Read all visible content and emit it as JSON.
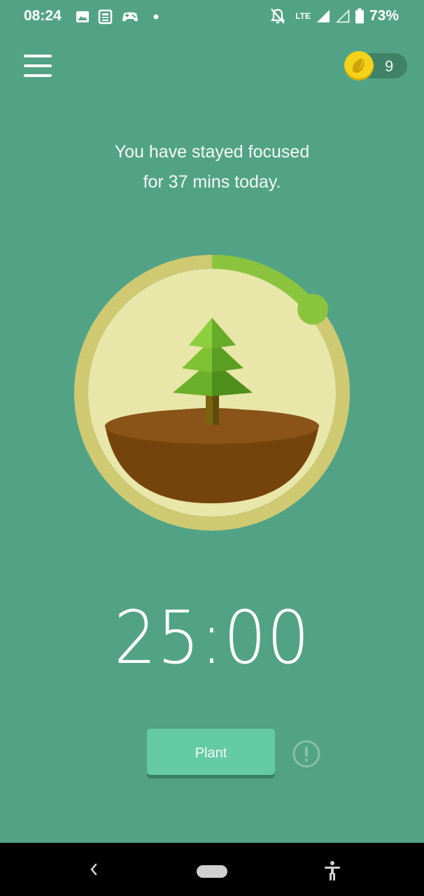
{
  "status_bar": {
    "time": "08:24",
    "left_icons": [
      "image-icon",
      "news-icon",
      "game-controller-icon",
      "dot-icon"
    ],
    "right_icons": [
      "notifications-off-icon",
      "lte-icon",
      "signal-icon",
      "signal-empty-icon",
      "battery-icon"
    ],
    "network": "LTE",
    "battery": "73%"
  },
  "header": {
    "menu_icon": "hamburger-menu-icon",
    "coin_icon": "coin-icon",
    "coins": "9"
  },
  "focus_message": {
    "line1": "You have stayed focused",
    "line2": "for 37 mins today."
  },
  "tree_display": {
    "progress_fraction": 0.14,
    "tree_icon": "pine-tree-icon"
  },
  "timer": {
    "value": "25:00"
  },
  "actions": {
    "plant_label": "Plant",
    "info_icon": "exclamation-circle-icon"
  },
  "nav_bar": {
    "back_icon": "back-chevron-icon",
    "home_icon": "home-pill-icon",
    "accessibility_icon": "accessibility-icon"
  },
  "colors": {
    "background": "#52a385",
    "ring": "#cfc972",
    "ring_progress": "#8ac43c",
    "circle_fill": "#e8e6a8",
    "soil": "#8a5419",
    "button": "#64caa6",
    "coin": "#f4d21a"
  }
}
